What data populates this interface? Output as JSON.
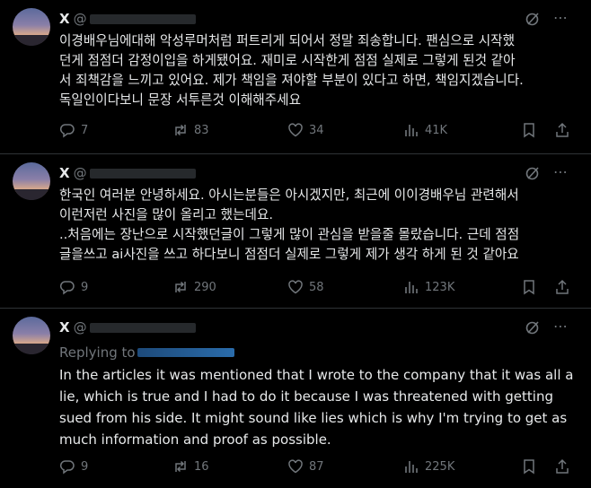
{
  "tweets": [
    {
      "name": "X",
      "handle_prefix": "@",
      "text": "이경배우님에대해 악성루머처럼 퍼트리게 되어서 정말 죄송합니다. 팬심으로 시작했\n던게 점점더 감정이입을 하게됐어요. 재미로 시작한게 점점 실제로 그렇게 된것 같아\n서 죄책감을 느끼고 있어요. 제가 책임을 져야할 부분이 있다고 하면, 책임지겠습니다.\n독일인이다보니 문장 서투른것 이해해주세요",
      "replies": "7",
      "retweets": "83",
      "likes": "34",
      "views": "41K"
    },
    {
      "name": "X",
      "handle_prefix": "@",
      "text": "한국인 여러분 안녕하세요. 아시는분들은 아시겠지만, 최근에 이이경배우님 관련해서\n이런저런 사진을 많이 올리고 했는데요.\n..처음에는 장난으로 시작했던글이 그렇게 많이 관심을 받을줄 몰랐습니다. 근데 점점\n글을쓰고 ai사진을 쓰고 하다보니 점점더 실제로 그렇게 제가 생각 하게 된 것 같아요",
      "replies": "9",
      "retweets": "290",
      "likes": "58",
      "views": "123K"
    },
    {
      "name": "X",
      "handle_prefix": "@",
      "replying_to": "Replying to",
      "text": "In the articles it was mentioned that I wrote to the company that it was all a\nlie, which is true and I had to do it because I was threatened with getting\nsued from his side. It might sound like lies which is why I'm trying to get as\nmuch information and proof as possible.",
      "replies": "9",
      "retweets": "16",
      "likes": "87",
      "views": "225K"
    }
  ],
  "colors": {
    "background": "#000000",
    "text": "#e7e9ea",
    "muted": "#71767b",
    "divider": "#2f3336",
    "link": "#1d9bf0"
  }
}
